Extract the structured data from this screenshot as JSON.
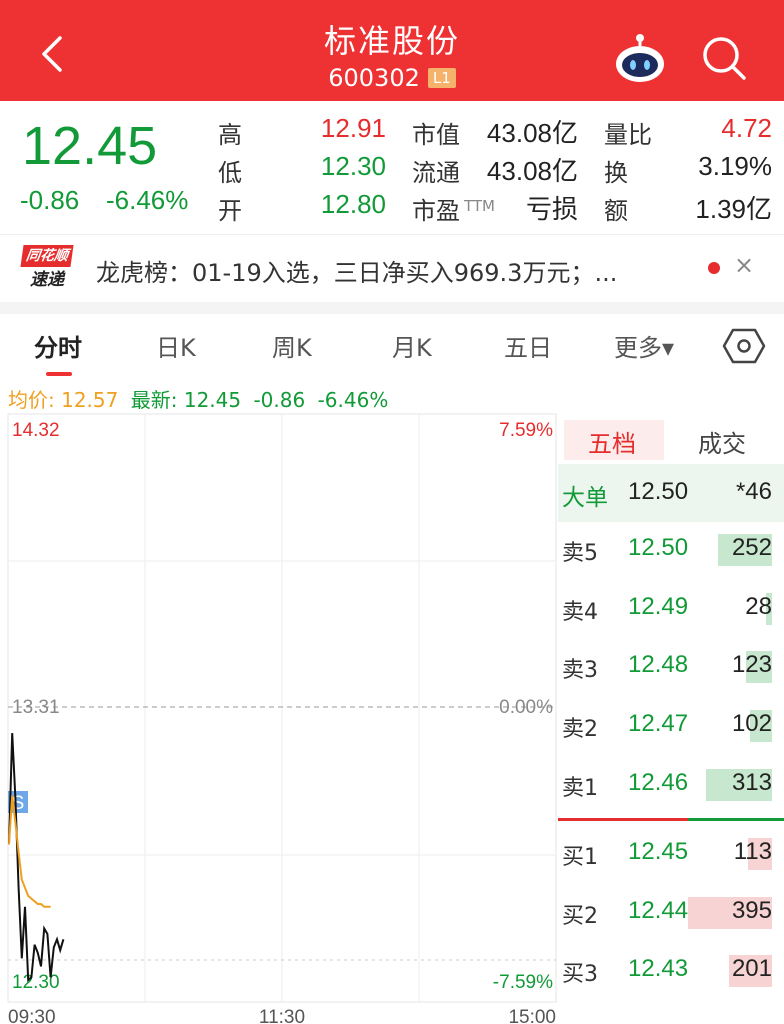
{
  "header": {
    "title": "标准股份",
    "code": "600302",
    "level_badge": "L1",
    "back_icon": "chevron-left-icon",
    "robot_icon": "robot-assistant-icon",
    "search_icon": "search-icon"
  },
  "quote": {
    "price": "12.45",
    "change": "-0.86",
    "change_pct": "-6.46%",
    "high_label": "高",
    "high": "12.91",
    "low_label": "低",
    "low": "12.30",
    "open_label": "开",
    "open": "12.80",
    "mcap_label": "市值",
    "mcap": "43.08亿",
    "float_label": "流通",
    "float": "43.08亿",
    "pe_label": "市盈",
    "pe_suffix": "TTM",
    "pe": "亏损",
    "vol_ratio_label": "量比",
    "vol_ratio": "4.72",
    "turnover_label": "换",
    "turnover": "3.19%",
    "amount_label": "额",
    "amount": "1.39亿"
  },
  "news": {
    "logo_line1": "同花顺",
    "logo_line2": "速递",
    "text": "龙虎榜：01-19入选，三日净买入969.3万元；...",
    "close": "×"
  },
  "tabs": [
    "分时",
    "日K",
    "周K",
    "月K",
    "五日",
    "更多▾"
  ],
  "summary": {
    "avg_label": "均价:",
    "avg": "12.57",
    "latest_label": "最新:",
    "latest": "12.45",
    "change": "-0.86",
    "change_pct": "-6.46%"
  },
  "chart_data": {
    "type": "line",
    "y_left_ticks": [
      "14.32",
      "13.31",
      "12.30"
    ],
    "y_right_ticks": [
      "7.59%",
      "0.00%",
      "-7.59%"
    ],
    "x_ticks": [
      "09:30",
      "11:30",
      "15:00"
    ],
    "ylim": [
      12.3,
      14.32
    ],
    "marker": "S",
    "series": [
      {
        "values": [
          12.8,
          13.21,
          12.97,
          12.64,
          12.38,
          12.57,
          12.3,
          12.31,
          12.43,
          12.4,
          12.35,
          12.49,
          12.47,
          12.31,
          12.42,
          12.45,
          12.41,
          12.45
        ]
      },
      {
        "values": [
          12.8,
          12.98,
          12.88,
          12.77,
          12.67,
          12.64,
          12.61,
          12.6,
          12.59,
          12.58,
          12.58,
          12.57,
          12.57,
          12.57
        ]
      }
    ]
  },
  "order_book": {
    "tab_five": "五档",
    "tab_trades": "成交",
    "big_label": "大单",
    "big_price": "12.50",
    "big_vol": "*46",
    "sells": [
      {
        "label": "卖5",
        "price": "12.50",
        "vol": "252",
        "bar": 0.64
      },
      {
        "label": "卖4",
        "price": "12.49",
        "vol": "28",
        "bar": 0.07
      },
      {
        "label": "卖3",
        "price": "12.48",
        "vol": "123",
        "bar": 0.31
      },
      {
        "label": "卖2",
        "price": "12.47",
        "vol": "102",
        "bar": 0.26
      },
      {
        "label": "卖1",
        "price": "12.46",
        "vol": "313",
        "bar": 0.79
      }
    ],
    "buys": [
      {
        "label": "买1",
        "price": "12.45",
        "vol": "113",
        "bar": 0.29
      },
      {
        "label": "买2",
        "price": "12.44",
        "vol": "395",
        "bar": 1.0
      },
      {
        "label": "买3",
        "price": "12.43",
        "vol": "201",
        "bar": 0.51
      }
    ]
  }
}
